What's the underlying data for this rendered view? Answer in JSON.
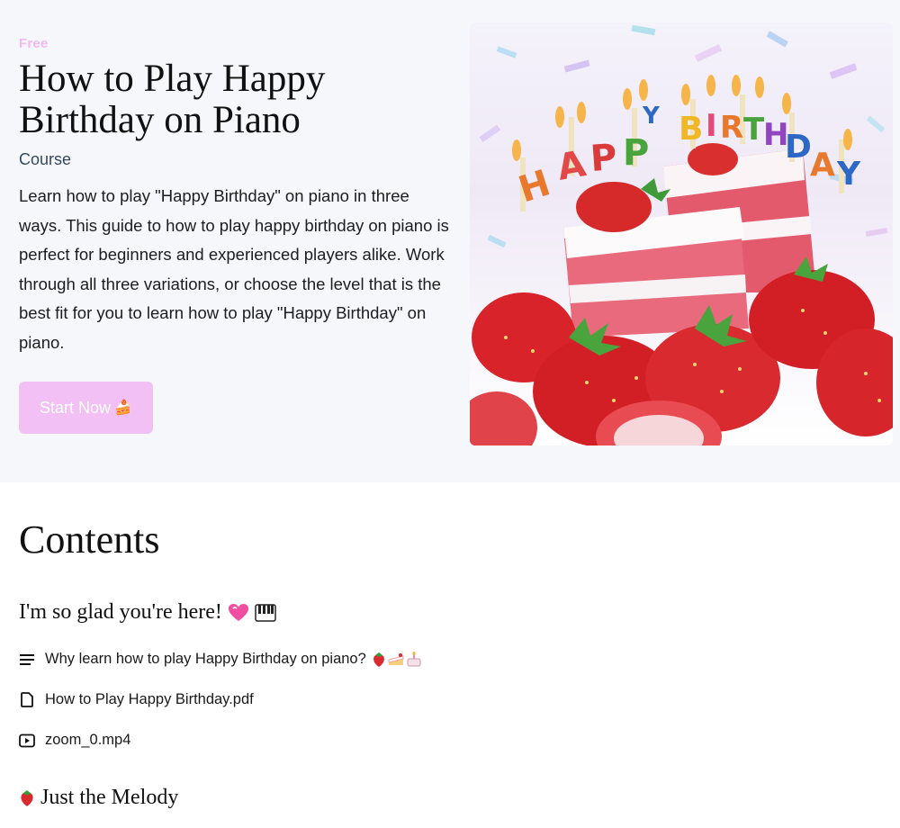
{
  "course": {
    "badge": "Free",
    "title": "How to Play Happy Birthday on Piano",
    "type": "Course",
    "description": "Learn how to play \"Happy Birthday\" on piano in three ways. This guide to how to play happy birthday on piano is perfect for beginners and experienced players alike. Work through all three variations, or choose the level that is the best fit for you to learn how to play \"Happy Birthday\" on piano.",
    "cta_label": "Start Now",
    "cta_emoji": "🍰",
    "image_banner": "HAPPY BIRTHDAY"
  },
  "contents": {
    "title": "Contents",
    "sections": [
      {
        "title": "I'm so glad you're here!",
        "lessons": [
          {
            "label": "Why learn how to play Happy Birthday on piano?",
            "icon": "text-lines-icon"
          },
          {
            "label": "How to Play Happy Birthday.pdf",
            "icon": "document-icon"
          },
          {
            "label": "zoom_0.mp4",
            "icon": "video-icon"
          }
        ]
      },
      {
        "title": "Just the Melody"
      }
    ]
  },
  "colors": {
    "badge": "#f2b8f5",
    "cta_bg": "#f2c0f5",
    "hero_bg": "#f6f7fb"
  }
}
